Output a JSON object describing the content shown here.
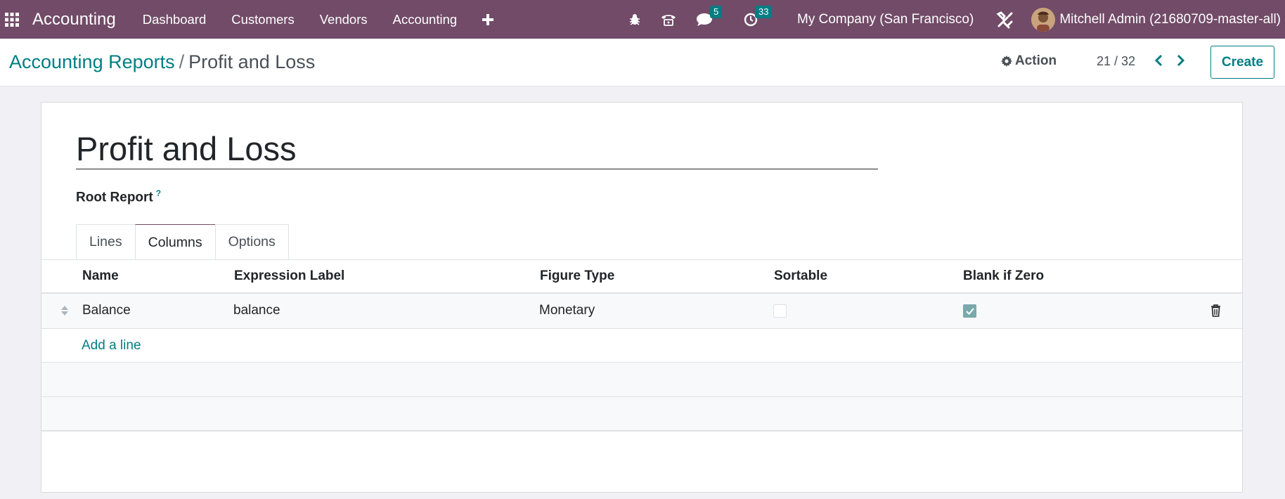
{
  "navbar": {
    "brand": "Accounting",
    "menu": [
      "Dashboard",
      "Customers",
      "Vendors",
      "Accounting"
    ],
    "messages_count": "5",
    "activities_count": "33",
    "company": "My Company (San Francisco)",
    "user": "Mitchell Admin (21680709-master-all)"
  },
  "breadcrumb": {
    "parent": "Accounting Reports",
    "separator": "/",
    "current": "Profit and Loss"
  },
  "toolbar": {
    "action_label": "Action",
    "pager": "21 / 32",
    "create_label": "Create"
  },
  "form": {
    "title": "Profit and Loss",
    "root_report_label": "Root Report",
    "help_mark": "?",
    "tabs": [
      "Lines",
      "Columns",
      "Options"
    ],
    "active_tab": "Columns"
  },
  "table": {
    "headers": [
      "Name",
      "Expression Label",
      "Figure Type",
      "Sortable",
      "Blank if Zero"
    ],
    "rows": [
      {
        "name": "Balance",
        "expression_label": "balance",
        "figure_type": "Monetary",
        "sortable": false,
        "blank_if_zero": true
      }
    ],
    "add_line": "Add a line"
  },
  "colors": {
    "brand": "#714b67",
    "accent": "#017e84"
  }
}
